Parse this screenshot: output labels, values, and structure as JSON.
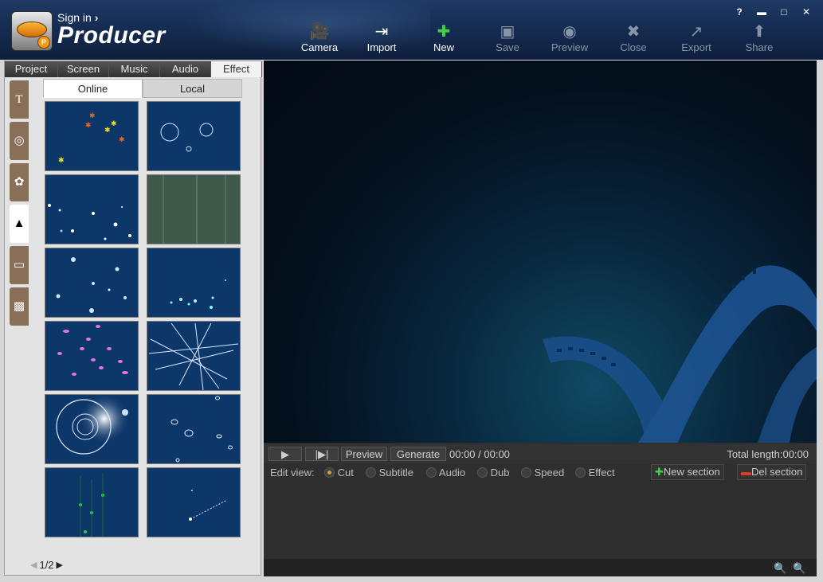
{
  "header": {
    "sign_in": "Sign in",
    "sign_in_arrow": "›",
    "app_name": "Producer",
    "logo_badge": "P"
  },
  "toolbar": [
    {
      "label": "Camera",
      "icon": "camera-icon",
      "glyph": "🎥",
      "enabled": true
    },
    {
      "label": "Import",
      "icon": "import-icon",
      "glyph": "⇥",
      "enabled": true
    },
    {
      "label": "New",
      "icon": "new-icon",
      "glyph": "✚",
      "enabled": true
    },
    {
      "label": "Save",
      "icon": "save-icon",
      "glyph": "▣",
      "enabled": false
    },
    {
      "label": "Preview",
      "icon": "eye-icon",
      "glyph": "◉",
      "enabled": false
    },
    {
      "label": "Close",
      "icon": "close-doc-icon",
      "glyph": "✖",
      "enabled": false
    },
    {
      "label": "Export",
      "icon": "export-icon",
      "glyph": "↗",
      "enabled": false
    },
    {
      "label": "Share",
      "icon": "share-icon",
      "glyph": "⬆",
      "enabled": false
    }
  ],
  "window_controls": {
    "help": "?",
    "minimize": "▬",
    "maximize": "□",
    "close": "✕"
  },
  "left_panel": {
    "tabs": [
      "Project",
      "Screen",
      "Music",
      "Audio",
      "Effect"
    ],
    "active_tab": "Effect",
    "side_tabs": [
      {
        "name": "text-icon",
        "glyph": "T"
      },
      {
        "name": "shapes-icon",
        "glyph": "◎"
      },
      {
        "name": "color-wheel-icon",
        "glyph": "✿"
      },
      {
        "name": "mountain-icon",
        "glyph": "▲"
      },
      {
        "name": "frame-icon",
        "glyph": "▭"
      },
      {
        "name": "picture-icon",
        "glyph": "▩"
      }
    ],
    "active_side_tab": 3,
    "sub_tabs": [
      "Online",
      "Local"
    ],
    "active_sub_tab": "Online",
    "pager": {
      "current": "1/2",
      "prev_icon": "◀",
      "next_icon": "▶"
    }
  },
  "controls": {
    "play": "▶",
    "step": "|▶|",
    "preview": "Preview",
    "generate": "Generate",
    "time": "00:00 / 00:00",
    "total_length": "Total length:00:00",
    "edit_view_label": "Edit view:",
    "edit_options": [
      "Cut",
      "Subtitle",
      "Audio",
      "Dub",
      "Speed",
      "Effect"
    ],
    "selected_option": "Cut",
    "new_section": "New section",
    "del_section": "Del section",
    "new_icon": "✚",
    "del_icon": "▬",
    "zoom_in_icon": "🔍",
    "zoom_out_icon": "🔍"
  },
  "colors": {
    "title_bar": "#142a4e",
    "accent": "#c9a53a",
    "thumb_bg": "#0d3669",
    "new_green": "#3fcf4a",
    "del_red": "#e0382f"
  }
}
